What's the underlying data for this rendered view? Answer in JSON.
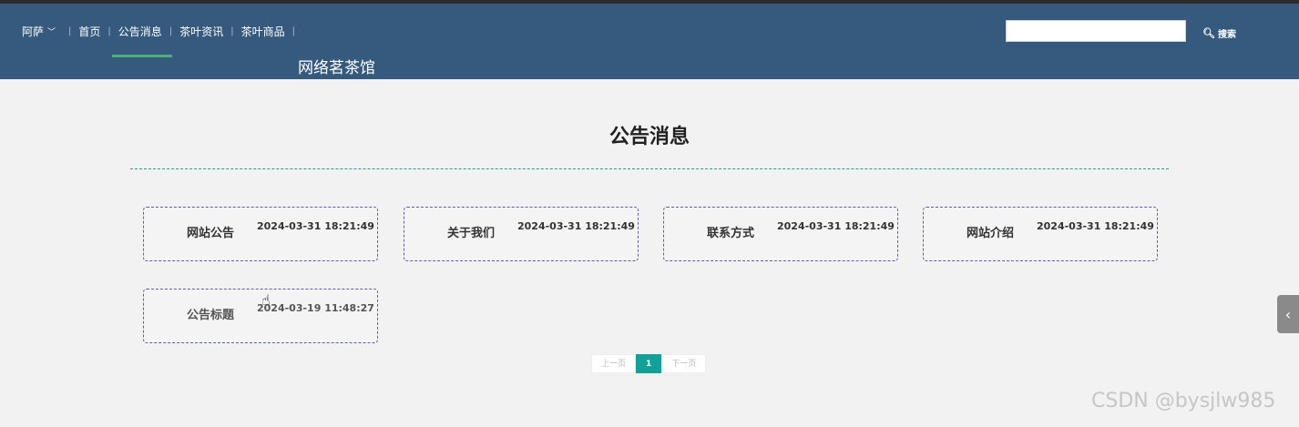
{
  "header": {
    "user": "阿萨",
    "nav": [
      "首页",
      "公告消息",
      "茶叶资讯",
      "茶叶商品"
    ],
    "site_title": "网络茗茶馆",
    "search_placeholder": "",
    "search_label": "搜索"
  },
  "main": {
    "title": "公告消息",
    "notices": [
      {
        "title": "网站公告",
        "date": "2024-03-31 18:21:49"
      },
      {
        "title": "关于我们",
        "date": "2024-03-31 18:21:49"
      },
      {
        "title": "联系方式",
        "date": "2024-03-31 18:21:49"
      },
      {
        "title": "网站介绍",
        "date": "2024-03-31 18:21:49"
      },
      {
        "title": "公告标题",
        "date": "2024-03-19 11:48:27"
      }
    ],
    "pager": {
      "prev": "上一页",
      "current": "1",
      "next": "下一页"
    }
  },
  "watermark": "CSDN @bysjlw985",
  "icons": {
    "user_menu": "chevron-down-icon",
    "search": "search-icon",
    "side_tab": "chevron-left-icon"
  },
  "colors": {
    "header_bg": "#355a7d",
    "accent": "#139f9a",
    "nav_active": "#4caf7a"
  }
}
